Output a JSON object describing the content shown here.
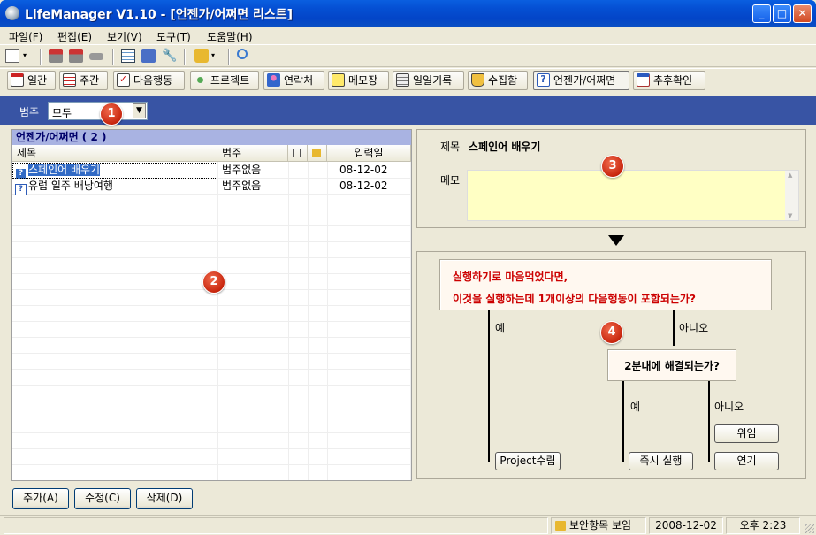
{
  "window": {
    "title": "LifeManager V1.10 - [언젠가/어쩌면 리스트]"
  },
  "menu": [
    "파일(F)",
    "편집(E)",
    "보기(V)",
    "도구(T)",
    "도움말(H)"
  ],
  "views": [
    {
      "label": "일간",
      "icon": "calendar-day-icon"
    },
    {
      "label": "주간",
      "icon": "calendar-week-icon"
    },
    {
      "label": "다음행동",
      "icon": "checkbox-icon"
    },
    {
      "label": "프로젝트",
      "icon": "project-tree-icon"
    },
    {
      "label": "연락처",
      "icon": "person-icon"
    },
    {
      "label": "메모장",
      "icon": "notepad-icon"
    },
    {
      "label": "일일기록",
      "icon": "journal-icon"
    },
    {
      "label": "수집함",
      "icon": "inbox-icon"
    },
    {
      "label": "언젠가/어쩌면",
      "icon": "question-icon"
    },
    {
      "label": "추후확인",
      "icon": "followup-icon"
    }
  ],
  "category": {
    "label": "범주",
    "value": "모두"
  },
  "list": {
    "title": "언젠가/어쩌면 ( 2 )",
    "headers": [
      "제목",
      "범주",
      "입력일"
    ],
    "rows": [
      {
        "title": "스페인어 배우기",
        "category": "범주없음",
        "date": "08-12-02"
      },
      {
        "title": "유럽 일주 배낭여행",
        "category": "범주없음",
        "date": "08-12-02"
      }
    ]
  },
  "buttons": {
    "add": "추가(A)",
    "edit": "수정(C)",
    "delete": "삭제(D)"
  },
  "detail": {
    "title_label": "제목",
    "title_value": "스페인어 배우기",
    "memo_label": "메모"
  },
  "flow": {
    "question1_line1": "실행하기로 마음먹었다면,",
    "question1_line2": "이것을 실행하는데 1개이상의 다음행동이 포함되는가?",
    "yes1": "예",
    "no1": "아니오",
    "question2": "2분내에 해결되는가?",
    "yes2": "예",
    "no2": "아니오",
    "btn_project": "Project수립",
    "btn_now": "즉시 실행",
    "btn_delegate": "위임",
    "btn_defer": "연기"
  },
  "status": {
    "security": "보안항목 보임",
    "date": "2008-12-02",
    "time": "오후 2:23"
  },
  "badges": [
    "1",
    "2",
    "3",
    "4"
  ],
  "colors": {
    "titlebar": "#0550d4",
    "category_bar": "#3854a4",
    "question_text": "#cc0000",
    "badge": "#d0321a",
    "selection": "#316ac5"
  }
}
